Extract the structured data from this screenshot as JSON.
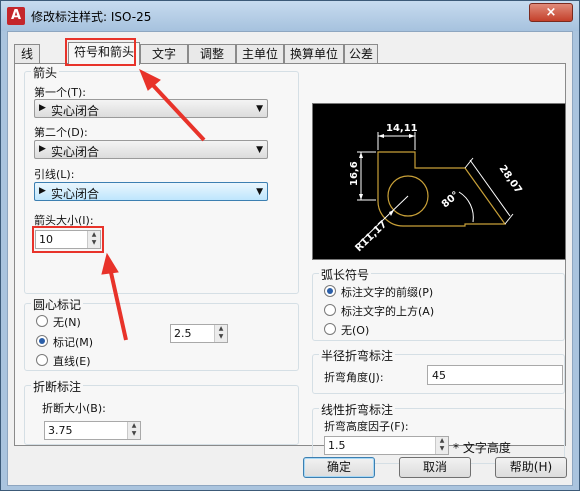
{
  "window": {
    "title": "修改标注样式: ISO-25",
    "app_icon": "A",
    "close_glyph": "×"
  },
  "tabs": [
    {
      "label": "线",
      "active": false
    },
    {
      "label": "符号和箭头",
      "active": true
    },
    {
      "label": "文字",
      "active": false
    },
    {
      "label": "调整",
      "active": false
    },
    {
      "label": "主单位",
      "active": false
    },
    {
      "label": "换算单位",
      "active": false
    },
    {
      "label": "公差",
      "active": false
    }
  ],
  "arrowheads": {
    "group_title": "箭头",
    "first_label": "第一个(T):",
    "first_value": "实心闭合",
    "second_label": "第二个(D):",
    "second_value": "实心闭合",
    "leader_label": "引线(L):",
    "leader_value": "实心闭合",
    "size_label": "箭头大小(I):",
    "size_value": "10"
  },
  "center_marks": {
    "group_title": "圆心标记",
    "none_label": "无(N)",
    "mark_label": "标记(M)",
    "line_label": "直线(E)",
    "selected": "mark",
    "size_value": "2.5"
  },
  "break": {
    "group_title": "折断标注",
    "size_label": "折断大小(B):",
    "size_value": "3.75"
  },
  "preview": {
    "dim_top": "14,11",
    "dim_left": "16,6",
    "dim_right": "28,07",
    "dim_angle": "80°",
    "dim_radius": "R11,17"
  },
  "arc_symbol": {
    "group_title": "弧长符号",
    "opt_prefix": "标注文字的前缀(P)",
    "opt_above": "标注文字的上方(A)",
    "opt_none": "无(O)",
    "selected": "prefix"
  },
  "radius_jog": {
    "group_title": "半径折弯标注",
    "angle_label": "折弯角度(J):",
    "angle_value": "45"
  },
  "linear_jog": {
    "group_title": "线性折弯标注",
    "factor_label": "折弯高度因子(F):",
    "factor_value": "1.5",
    "unit_label": "* 文字高度"
  },
  "buttons": {
    "ok": "确定",
    "cancel": "取消",
    "help": "帮助(H)"
  },
  "colors": {
    "highlight_red": "#e8332a",
    "preview_line": "#c8a038"
  }
}
